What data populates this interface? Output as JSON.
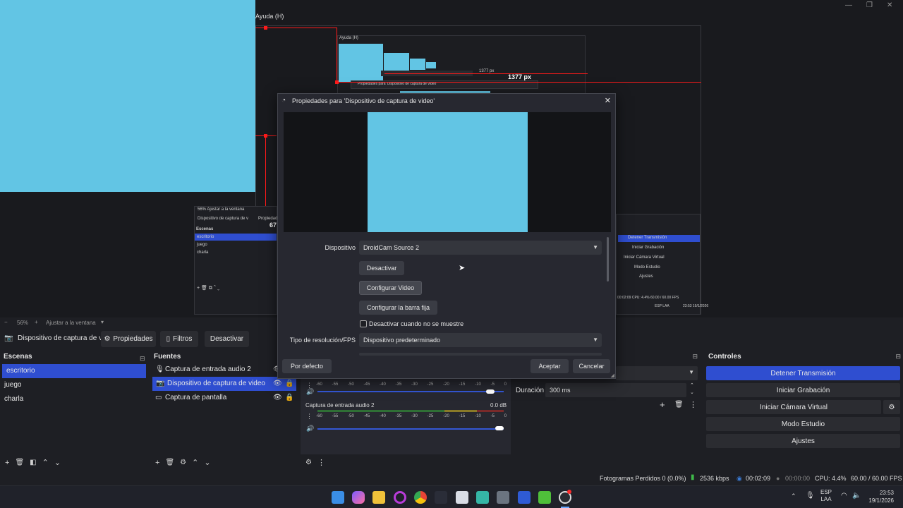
{
  "menu": {
    "help": "Ayuda (H)"
  },
  "preview_echo": {
    "help_small": "Ayuda (H)",
    "px_small": "1377 px",
    "px_large": "1377 px",
    "dialog_small_title": "Propiedades para 'Dispositivo de captura de video'",
    "scenes_title_small": "Escenas",
    "scene_small_1": "escritorio",
    "scene_small_2": "juego",
    "scene_small_3": "charla",
    "zoom_small": "56%",
    "fit_small": "Ajustar a la ventana",
    "tab_small_1": "Dispositivo de captura de v",
    "tab_small_2": "Propiedades",
    "num_small": "67",
    "ctrl_small_1": "Detener Transmisión",
    "ctrl_small_2": "Iniciar Grabación",
    "ctrl_small_3": "Iniciar Cámara Virtual",
    "ctrl_small_4": "Modo Estudio",
    "ctrl_small_5": "Ajustes",
    "status_small": "00:02:09   CPU: 4.4%   60.00 / 60.00 FPS",
    "lang_small": "ESP LAA",
    "time_small": "23:53",
    "date_small": "19/1/2026"
  },
  "zoom_bar": {
    "minus": "−",
    "zoom": "56%",
    "plus": "+",
    "fit": "Ajustar a la ventana"
  },
  "source_toolbar": {
    "source_name": "Dispositivo de captura de v",
    "properties": "Propiedades",
    "filters": "Filtros",
    "deactivate": "Desactivar"
  },
  "scenes": {
    "title": "Escenas",
    "items": [
      "escritorio",
      "juego",
      "charla"
    ],
    "selected": "escritorio"
  },
  "sources": {
    "title": "Fuentes",
    "items": [
      {
        "label": "Captura de entrada audio 2",
        "icon": "mic-icon"
      },
      {
        "label": "Dispositivo de captura de video",
        "icon": "camera-icon"
      },
      {
        "label": "Captura de pantalla",
        "icon": "monitor-icon"
      }
    ],
    "selected": "Dispositivo de captura de video"
  },
  "mixer": {
    "scale": [
      "-60",
      "-55",
      "-50",
      "-45",
      "-40",
      "-35",
      "-30",
      "-25",
      "-20",
      "-15",
      "-10",
      "-5",
      "0"
    ],
    "channel_2_name": "Captura de entrada audio 2",
    "channel_2_db": "0.0 dB",
    "channel_1_volume": 0.95,
    "channel_2_volume": 1.0
  },
  "transitions": {
    "duration_label": "Duración",
    "duration_value": "300 ms"
  },
  "controls": {
    "title": "Controles",
    "buttons": [
      "Detener Transmisión",
      "Iniciar Grabación",
      "Iniciar Cámara Virtual",
      "Modo Estudio",
      "Ajustes"
    ]
  },
  "dialog": {
    "title": "Propiedades para 'Dispositivo de captura de video'",
    "device_label": "Dispositivo",
    "device_value": "DroidCam Source 2",
    "btn_deactivate": "Desactivar",
    "btn_config_video": "Configurar Video",
    "btn_config_bar": "Configurar la barra fija",
    "checkbox_label": "Desactivar cuando no se muestre",
    "checkbox_checked": false,
    "res_label": "Tipo de resolución/FPS",
    "res_value": "Dispositivo predeterminado",
    "defaults": "Por defecto",
    "accept": "Aceptar",
    "cancel": "Cancelar"
  },
  "status": {
    "dropped": "Fotogramas Perdidos 0 (0.0%)",
    "bitrate": "2536 kbps",
    "stream_time": "00:02:09",
    "rec_time": "00:00:00",
    "cpu": "CPU: 4.4%",
    "fps": "60.00 / 60.00 FPS"
  },
  "taskbar": {
    "lang_1": "ESP",
    "lang_2": "LAA",
    "time": "23:53",
    "date": "19/1/2026"
  },
  "colors": {
    "accent": "#2f4ed0",
    "preview_cyan": "#62c5e4",
    "guide_red": "#ff1a1a"
  }
}
